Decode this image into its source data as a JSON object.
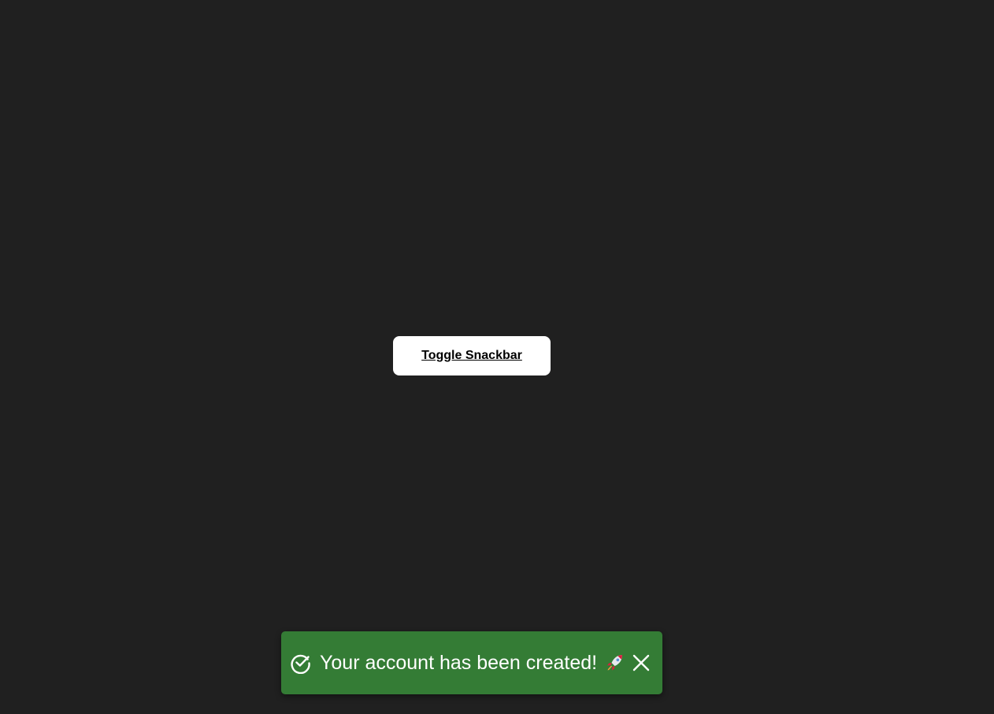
{
  "toggle_button": {
    "label": "Toggle Snackbar"
  },
  "snackbar": {
    "message": "Your account has been created!",
    "status_icon": "check-circle-icon",
    "emoji_icon": "rocket-icon",
    "close_icon": "close-icon"
  },
  "colors": {
    "background": "#202020",
    "snackbar_background": "#347c35",
    "button_background": "#ffffff"
  }
}
